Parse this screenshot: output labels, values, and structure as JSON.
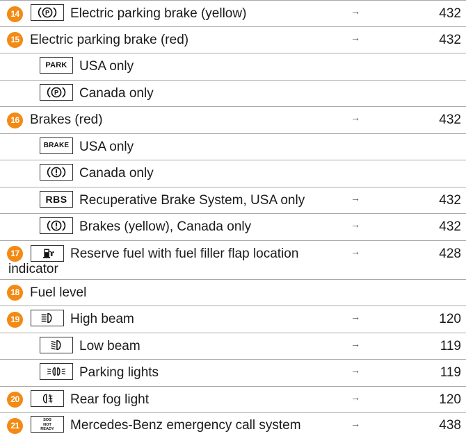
{
  "rows": [
    {
      "num": "14",
      "icon_name": "parking-brake-circle-p-icon",
      "text": "Electric parking brake (yellow)",
      "arrow": "→",
      "page": "432"
    },
    {
      "num": "15",
      "text": "Electric parking brake (red)",
      "arrow": "→",
      "page": "432"
    },
    {
      "icon_name": "park-text-icon",
      "icon_text": "PARK",
      "text": "USA only"
    },
    {
      "icon_name": "parking-brake-circle-p-icon",
      "text": "Canada only"
    },
    {
      "num": "16",
      "text": "Brakes (red)",
      "arrow": "→",
      "page": "432"
    },
    {
      "icon_name": "brake-text-icon",
      "icon_text": "BRAKE",
      "text": "USA only"
    },
    {
      "icon_name": "brake-exclamation-icon",
      "text": "Canada only"
    },
    {
      "icon_name": "rbs-text-icon",
      "icon_text": "RBS",
      "text": "Recuperative Brake System, USA only",
      "arrow": "→",
      "page": "432"
    },
    {
      "icon_name": "brake-exclamation-icon",
      "text": "Brakes (yellow), Canada only",
      "arrow": "→",
      "page": "432"
    },
    {
      "num": "17",
      "icon_name": "fuel-pump-icon",
      "text_line1": "Reserve fuel with fuel filler flap location",
      "text_line2": "indicator",
      "arrow": "→",
      "page": "428"
    },
    {
      "num": "18",
      "text": "Fuel level"
    },
    {
      "num": "19",
      "icon_name": "high-beam-icon",
      "text": "High beam",
      "arrow": "→",
      "page": "120"
    },
    {
      "icon_name": "low-beam-icon",
      "text": "Low beam",
      "arrow": "→",
      "page": "119"
    },
    {
      "icon_name": "parking-lights-icon",
      "text": "Parking lights",
      "arrow": "→",
      "page": "119"
    },
    {
      "num": "20",
      "icon_name": "rear-fog-light-icon",
      "text": "Rear fog light",
      "arrow": "→",
      "page": "120"
    },
    {
      "num": "21",
      "icon_name": "sos-not-ready-icon",
      "icon_text_lines": [
        "SOS",
        "NOT",
        "READY"
      ],
      "text": "Mercedes-Benz emergency call system",
      "arrow": "→",
      "page": "438"
    }
  ],
  "colors": {
    "badge": "#f28a14",
    "rule": "#a9a9a9"
  }
}
